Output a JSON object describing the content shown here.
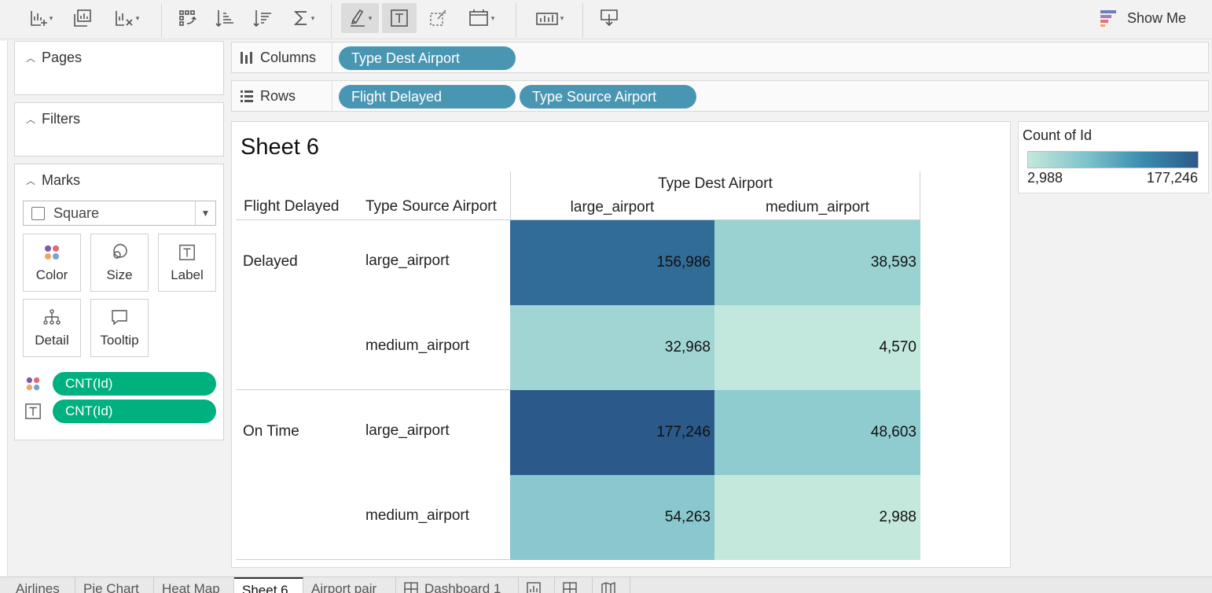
{
  "toolbar": {
    "buttons": [
      {
        "id": "new-worksheet",
        "icon": "chart-plus-icon",
        "caret": "▾"
      },
      {
        "id": "duplicate-sheet",
        "icon": "duplicate-chart-icon"
      },
      {
        "id": "clear-sheet",
        "icon": "chart-clear-icon",
        "caret": "▾"
      },
      {
        "id": "swap",
        "icon": "swap-icon"
      },
      {
        "id": "sort-asc",
        "icon": "sort-ascending-icon"
      },
      {
        "id": "sort-desc",
        "icon": "sort-descending-icon"
      },
      {
        "id": "totals",
        "icon": "sigma-icon",
        "caret": "▾"
      },
      {
        "id": "highlight",
        "icon": "highlighter-icon",
        "caret": "▾"
      },
      {
        "id": "show-labels",
        "icon": "text-label-icon"
      },
      {
        "id": "format",
        "icon": "format-brush-icon"
      },
      {
        "id": "fit",
        "icon": "fit-frame-icon",
        "caret": "▾"
      },
      {
        "id": "show-cards",
        "icon": "bars-chart-icon",
        "caret": "▾"
      },
      {
        "id": "present",
        "icon": "present-download-icon"
      }
    ],
    "show_me_label": "Show Me"
  },
  "pages": {
    "title": "Pages"
  },
  "filters": {
    "title": "Filters"
  },
  "marks": {
    "title": "Marks",
    "mark_type": "Square",
    "buttons": {
      "color": "Color",
      "size": "Size",
      "label": "Label",
      "detail": "Detail",
      "tooltip": "Tooltip"
    },
    "pills": [
      {
        "icon": "color-dots-icon",
        "label": "CNT(Id)"
      },
      {
        "icon": "text-label-icon",
        "label": "CNT(Id)"
      }
    ]
  },
  "shelves": {
    "columns_label": "Columns",
    "rows_label": "Rows",
    "columns_pills": [
      "Type Dest Airport"
    ],
    "rows_pills": [
      "Flight Delayed",
      "Type Source Airport"
    ]
  },
  "view": {
    "title": "Sheet 6",
    "row_header_1": "Flight Delayed",
    "row_header_2": "Type Source Airport",
    "col_group_header": "Type Dest Airport",
    "col_headers": [
      "large_airport",
      "medium_airport"
    ],
    "groups": [
      {
        "label": "Delayed",
        "rows": [
          {
            "label": "large_airport",
            "values": [
              "156,986",
              "38,593"
            ]
          },
          {
            "label": "medium_airport",
            "values": [
              "32,968",
              "4,570"
            ]
          }
        ]
      },
      {
        "label": "On Time",
        "rows": [
          {
            "label": "large_airport",
            "values": [
              "177,246",
              "48,603"
            ]
          },
          {
            "label": "medium_airport",
            "values": [
              "54,263",
              "2,988"
            ]
          }
        ]
      }
    ]
  },
  "chart_data": {
    "type": "heatmap",
    "title": "Sheet 6",
    "x_field": "Type Dest Airport",
    "y_fields": [
      "Flight Delayed",
      "Type Source Airport"
    ],
    "columns": [
      "large_airport",
      "medium_airport"
    ],
    "rows": [
      {
        "flight_delayed": "Delayed",
        "type_source_airport": "large_airport",
        "values": [
          156986,
          38593
        ]
      },
      {
        "flight_delayed": "Delayed",
        "type_source_airport": "medium_airport",
        "values": [
          32968,
          4570
        ]
      },
      {
        "flight_delayed": "On Time",
        "type_source_airport": "large_airport",
        "values": [
          177246,
          48603
        ]
      },
      {
        "flight_delayed": "On Time",
        "type_source_airport": "medium_airport",
        "values": [
          54263,
          2988
        ]
      }
    ],
    "color_measure": "Count of Id",
    "color_range": [
      2988,
      177246
    ],
    "color_scale": [
      "#c4e8dc",
      "#80c4cc",
      "#3b8db0",
      "#2b5a8a"
    ]
  },
  "legend": {
    "title": "Count of Id",
    "min_label": "2,988",
    "max_label": "177,246"
  },
  "tabs": [
    {
      "label": "Airlines"
    },
    {
      "label": "Pie Chart"
    },
    {
      "label": "Heat Map"
    },
    {
      "label": "Sheet 6",
      "active": true
    },
    {
      "label": "Airport pair"
    },
    {
      "label": "Dashboard 1",
      "icon": "dashboard-icon"
    },
    {
      "label": "",
      "icon": "new-worksheet-icon"
    },
    {
      "label": "",
      "icon": "new-dashboard-icon"
    },
    {
      "label": "",
      "icon": "new-story-icon"
    }
  ]
}
